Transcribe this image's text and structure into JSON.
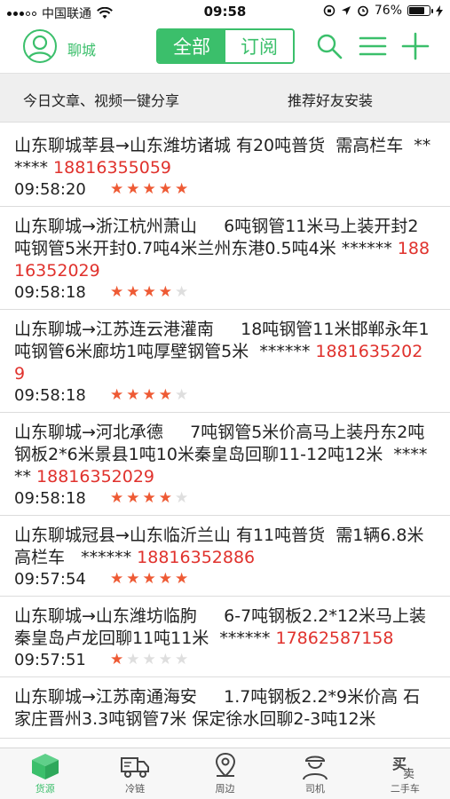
{
  "status_bar": {
    "carrier": "中国联通",
    "time": "09:58",
    "battery": "76%",
    "battery_level": 0.76
  },
  "header": {
    "city": "聊城",
    "tab_all": "全部",
    "tab_subscribe": "订阅",
    "icons": [
      "user-icon",
      "search-icon",
      "menu-icon",
      "plus-icon"
    ]
  },
  "share_bar": {
    "left": "今日文章、视频一键分享",
    "right": "推荐好友安装"
  },
  "posts": [
    {
      "text": "山东聊城莘县→山东潍坊诸城 有20吨普货  需高栏车  ******",
      "phone": "18816355059",
      "time": "09:58:20",
      "rating": 5
    },
    {
      "text": "山东聊城→浙江杭州萧山     6吨钢管11米马上装开封2吨钢管5米开封0.7吨4米兰州东港0.5吨4米 ******",
      "phone": "18816352029",
      "time": "09:58:18",
      "rating": 4
    },
    {
      "text": "山东聊城→江苏连云港灌南     18吨钢管11米邯郸永年1吨钢管6米廊坊1吨厚壁钢管5米  ******",
      "phone": "18816352029",
      "time": "09:58:18",
      "rating": 4
    },
    {
      "text": "山东聊城→河北承德     7吨钢管5米价高马上装丹东2吨钢板2*6米景县1吨10米秦皇岛回聊11-12吨12米  ******",
      "phone": "18816352029",
      "time": "09:58:18",
      "rating": 4
    },
    {
      "text": "山东聊城冠县→山东临沂兰山 有11吨普货  需1辆6.8米高栏车   ******",
      "phone": "18816352886",
      "time": "09:57:54",
      "rating": 5
    },
    {
      "text": "山东聊城→山东潍坊临朐     6-7吨钢板2.2*12米马上装 秦皇岛卢龙回聊11吨11米  ******",
      "phone": "17862587158",
      "time": "09:57:51",
      "rating": 1
    },
    {
      "text": "山东聊城→江苏南通海安     1.7吨钢板2.2*9米价高 石家庄晋州3.3吨钢管7米 保定徐水回聊2-3吨12米",
      "phone": "",
      "time": "",
      "rating": 0
    }
  ],
  "tabbar": [
    {
      "label": "货源",
      "icon": "box-icon",
      "active": true
    },
    {
      "label": "冷链",
      "icon": "truck-icon",
      "active": false
    },
    {
      "label": "周边",
      "icon": "location-icon",
      "active": false
    },
    {
      "label": "司机",
      "icon": "driver-icon",
      "active": false
    },
    {
      "label": "二手车",
      "icon": "buy-sell-icon",
      "active": false
    }
  ],
  "colors": {
    "accent": "#3bbf6b",
    "phone": "#e0322d",
    "star": "#ee5a34"
  }
}
